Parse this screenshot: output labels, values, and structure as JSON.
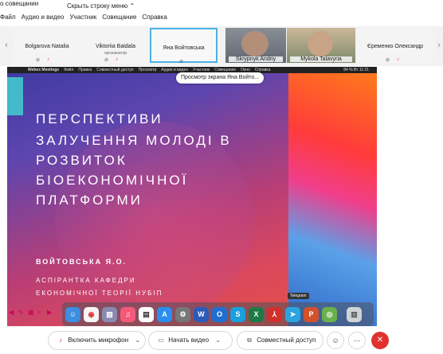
{
  "menu": {
    "title_fragment": "о совещании",
    "items": [
      "Файл",
      "Аудио и видео",
      "Участник",
      "Совещание",
      "Справка"
    ],
    "hide_menu": "Скрыть строку меню"
  },
  "participants": [
    {
      "name": "Bolgarova Natalia",
      "role": ""
    },
    {
      "name": "Viktoriia Baidala",
      "role": "организатор"
    },
    {
      "name": "Яна Войтовська",
      "role": ""
    },
    {
      "name": "Skrypnyk Andriy",
      "role": ""
    },
    {
      "name": "Mykola Talavyria",
      "role": ""
    },
    {
      "name": "Єременко Олександр",
      "role": ""
    }
  ],
  "share": {
    "app": "Webex Meetings",
    "mac_menu": [
      "Файл",
      "Правка",
      "Совместный доступ",
      "Просмотр",
      "Аудио и видео",
      "Участник",
      "Совещание",
      "Окно",
      "Справка"
    ],
    "status_right": "84 %  Вт 11:21",
    "tooltip": "Просмотр экрана Яна Войто..."
  },
  "slide": {
    "title_lines": [
      "ПЕРСПЕКТИВИ",
      "ЗАЛУЧЕННЯ МОЛОДІ В",
      "РОЗВИТОК",
      "БІОЕКОНОМІЧНОЇ",
      "ПЛАТФОРМИ"
    ],
    "author": "ВОЙТОВСЬКА Я.О.",
    "position_line1": "АСПІРАНТКА КАФЕДРИ",
    "position_line2": "ЕКОНОМІЧНОЇ ТЕОРІЇ НУБІП"
  },
  "dock": {
    "tooltip": "Telegram"
  },
  "controls": {
    "mic": "Включить микрофон",
    "video": "Начать видео",
    "share": "Совместный доступ"
  },
  "colors": {
    "accent": "#49b2e6",
    "end_call": "#e0332e"
  }
}
